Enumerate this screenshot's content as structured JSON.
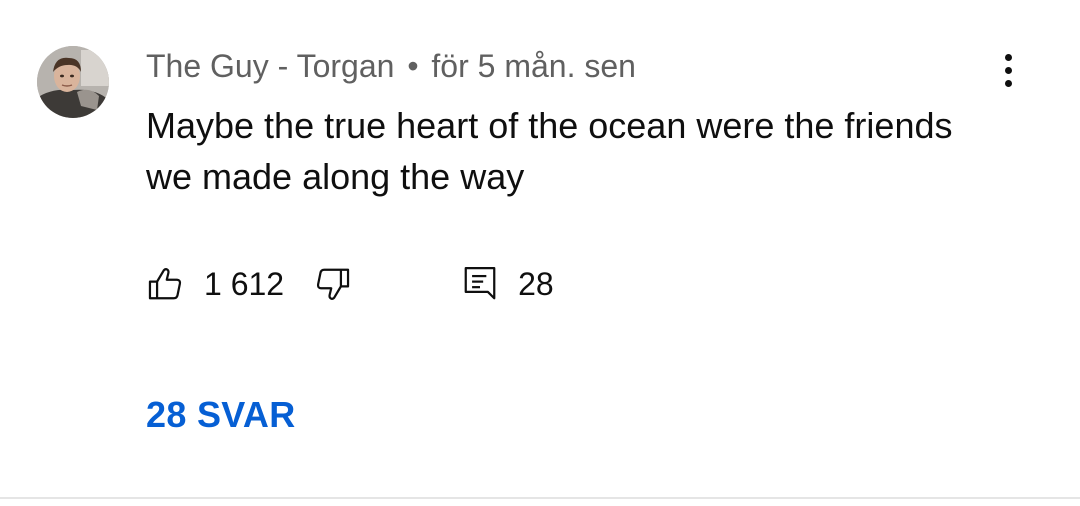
{
  "comment": {
    "author": "The Guy - Torgan",
    "separator": "•",
    "timestamp": "för 5 mån. sen",
    "text": "Maybe the true heart of the ocean were the friends we made along the way",
    "like_count": "1 612",
    "reply_count": "28",
    "replies_link": "28 SVAR"
  },
  "icons": {
    "avatar": "avatar",
    "menu": "more-vert-icon",
    "like": "thumbs-up-icon",
    "dislike": "thumbs-down-icon",
    "reply": "comment-icon"
  },
  "colors": {
    "meta_text": "#606060",
    "primary_text": "#0f0f0f",
    "link": "#065fd4",
    "divider": "#e5e5e5"
  }
}
